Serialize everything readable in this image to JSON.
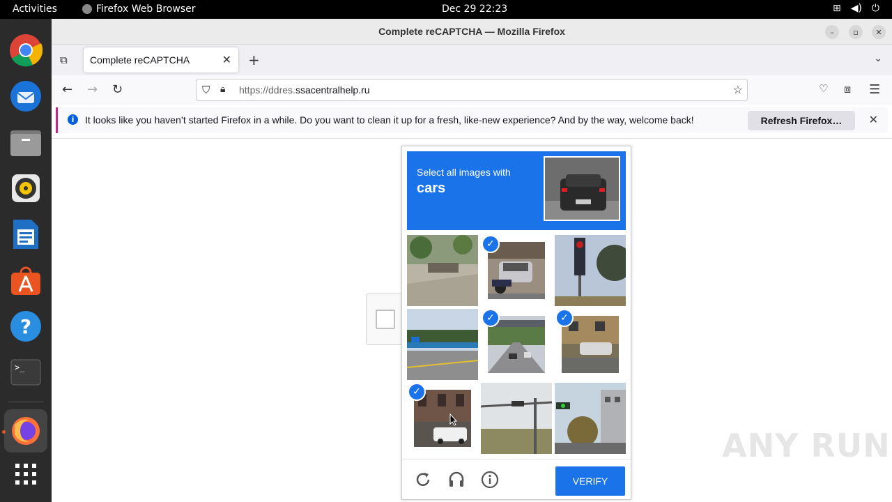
{
  "topbar": {
    "activities": "Activities",
    "app_name": "Firefox Web Browser",
    "clock": "Dec 29  22:23"
  },
  "dock": {
    "items": [
      "chrome-icon",
      "thunderbird-icon",
      "files-icon",
      "rhythmbox-icon",
      "writer-icon",
      "app-center-icon",
      "help-icon",
      "terminal-icon",
      "firefox-icon",
      "app-grid-icon"
    ]
  },
  "window": {
    "title": "Complete reCAPTCHA — Mozilla Firefox"
  },
  "tab": {
    "label": "Complete reCAPTCHA"
  },
  "urlbar": {
    "prefix": "https://ddres.",
    "host": "ssacentralhelp.ru"
  },
  "notification": {
    "message": "It looks like you haven’t started Firefox in a while. Do you want to clean it up for a fresh, like-new experience? And by the way, welcome back!",
    "button": "Refresh Firefox…"
  },
  "captcha": {
    "instruction": "Select all images with",
    "target": "cars",
    "tiles": [
      {
        "scene": "street-plaza",
        "selected": false
      },
      {
        "scene": "parked-car-motorbike",
        "selected": true
      },
      {
        "scene": "traffic-light-trees",
        "selected": false
      },
      {
        "scene": "bridge-road",
        "selected": false
      },
      {
        "scene": "road-overpass-cars",
        "selected": true
      },
      {
        "scene": "car-near-building",
        "selected": true
      },
      {
        "scene": "old-building-car",
        "selected": true
      },
      {
        "scene": "traffic-light-field",
        "selected": false
      },
      {
        "scene": "traffic-light-buildings",
        "selected": false
      }
    ],
    "verify_label": "VERIFY"
  },
  "watermark": "ANY RUN"
}
